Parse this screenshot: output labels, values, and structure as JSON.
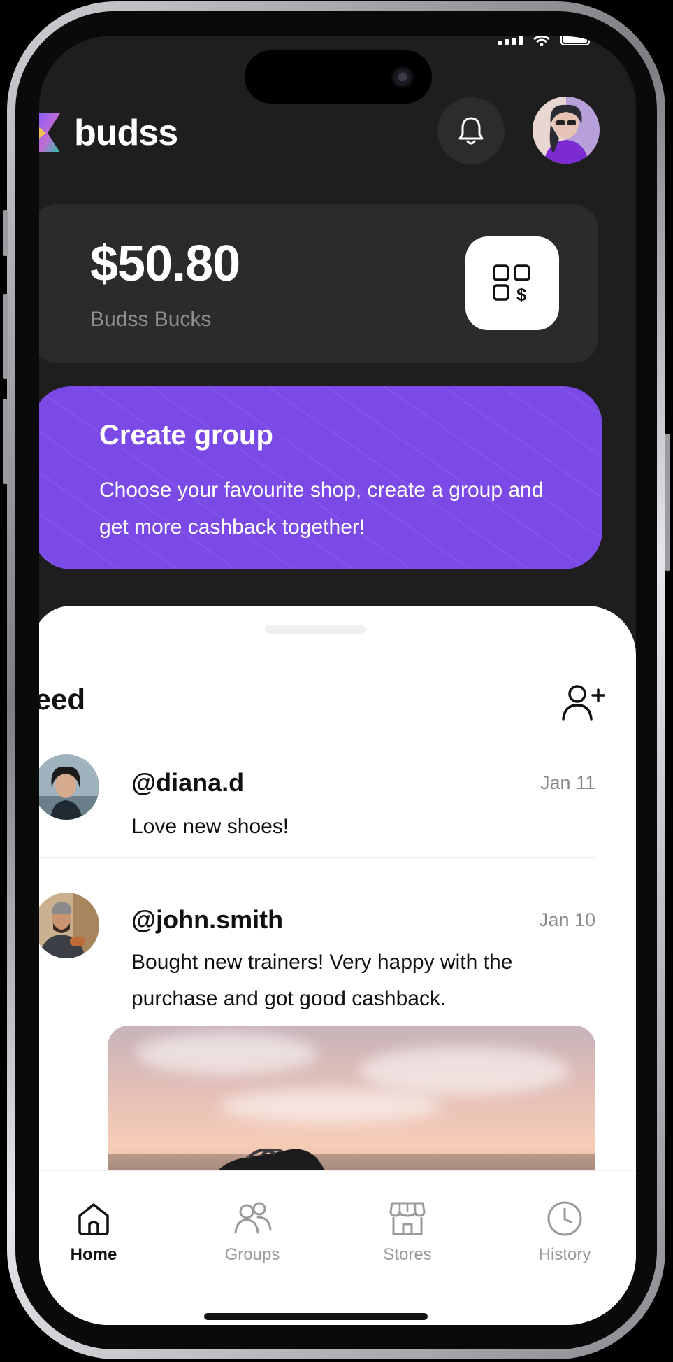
{
  "app": {
    "name": "budss"
  },
  "status_bar": {
    "icons": [
      "signal-icon",
      "wifi-icon",
      "battery-icon"
    ]
  },
  "header": {
    "notification_icon": "bell-icon",
    "avatar": "user-avatar"
  },
  "balance": {
    "amount": "$50.80",
    "label": "Budss Bucks",
    "action_icon": "qr-cash-icon"
  },
  "create_group": {
    "title": "Create group",
    "description": "Choose your favourite shop, create a group and get more cashback together!"
  },
  "feed": {
    "title": "Feed",
    "add_friend_icon": "add-user-icon",
    "posts": [
      {
        "user": "@diana.d",
        "date": "Jan 11",
        "text": "Love new shoes!"
      },
      {
        "user": "@john.smith",
        "date": "Jan 10",
        "text": "Bought new trainers! Very happy with the purchase and got good cashback."
      }
    ]
  },
  "tabs": [
    {
      "label": "Home",
      "icon": "home-icon",
      "active": true
    },
    {
      "label": "Groups",
      "icon": "groups-icon",
      "active": false
    },
    {
      "label": "Stores",
      "icon": "store-icon",
      "active": false
    },
    {
      "label": "History",
      "icon": "clock-icon",
      "active": false
    }
  ],
  "colors": {
    "accent": "#7A49E6",
    "background": "#1E1E1F",
    "card": "#2B2B2C",
    "sheet": "#FFFFFF"
  }
}
